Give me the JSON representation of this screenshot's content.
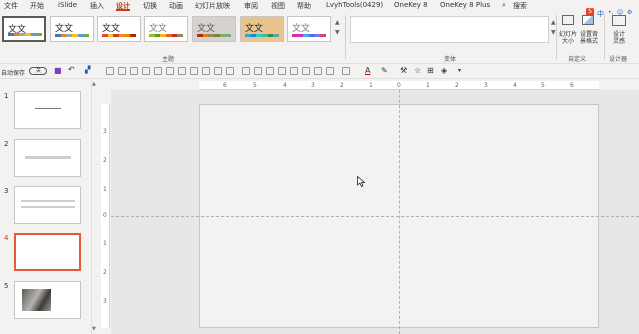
{
  "menu": {
    "items": [
      "文件",
      "开始",
      "iSlide",
      "插入",
      "设计",
      "切换",
      "动画",
      "幻灯片放映",
      "审阅",
      "视图",
      "帮助",
      "LvyhTools(0429)",
      "OneKey 8",
      "OneKey 8 Plus"
    ],
    "active": "设计",
    "search_label": "搜索"
  },
  "ribbon": {
    "themes": [
      {
        "text": "文文",
        "colors": [
          "#4472c4",
          "#ed7d31",
          "#a5a5a5",
          "#ffc000",
          "#5b9bd5",
          "#70ad47"
        ]
      },
      {
        "text": "文文",
        "colors": [
          "#4472c4",
          "#ed7d31",
          "#a5a5a5",
          "#ffc000",
          "#5b9bd5",
          "#70ad47"
        ]
      },
      {
        "text": "文文",
        "colors": [
          "#e84c22",
          "#ffbd47",
          "#b64926",
          "#ff8427",
          "#cc9900",
          "#b22600"
        ]
      },
      {
        "text": "文文",
        "colors": [
          "#90c226",
          "#54a021",
          "#e6b91e",
          "#e76618",
          "#c42f1a",
          "#918655"
        ]
      },
      {
        "text": "文文",
        "colors": [
          "#a53010",
          "#de7e18",
          "#9f8351",
          "#728653",
          "#92aa4c",
          "#6aac91"
        ]
      },
      {
        "text": "文文",
        "colors": [
          "#1cade4",
          "#2683c6",
          "#27ced7",
          "#42ba97",
          "#3e8853",
          "#62a39f"
        ]
      },
      {
        "text": "文文",
        "colors": [
          "#e32d91",
          "#c830cc",
          "#4ea6dc",
          "#4775e7",
          "#8971e1",
          "#d54773"
        ]
      }
    ],
    "group_theme": "主题",
    "group_variants": "变体",
    "group_customize": "自定义",
    "group_designer": "设计器",
    "btn_slide_size": "幻灯片\n大小",
    "btn_bg_format": "设置背\n景格式",
    "btn_design_ideas": "设计\n灵感",
    "ime_label": "中"
  },
  "toolbar": {
    "autosave_label": "自动保存",
    "autosave_state": "关"
  },
  "slides": [
    {
      "num": "1"
    },
    {
      "num": "2"
    },
    {
      "num": "3"
    },
    {
      "num": "4"
    },
    {
      "num": "5"
    }
  ],
  "ruler": {
    "h_labels": [
      "6",
      "5",
      "4",
      "3",
      "2",
      "1",
      "0",
      "1",
      "2",
      "3",
      "4",
      "5",
      "6"
    ],
    "v_labels": [
      "3",
      "2",
      "1",
      "0",
      "1",
      "2",
      "3"
    ]
  }
}
